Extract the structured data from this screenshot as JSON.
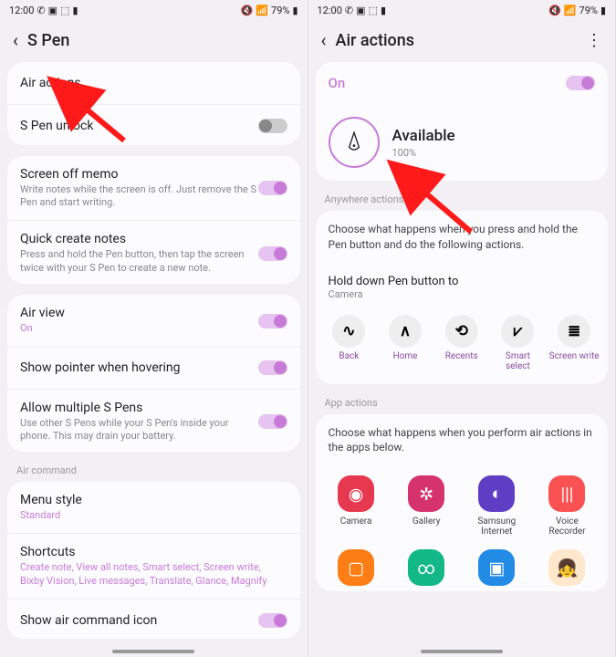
{
  "status": {
    "time": "12:00",
    "battery": "79%"
  },
  "left": {
    "title": "S Pen",
    "rows": {
      "air_actions": "Air actions",
      "unlock": "S Pen unlock",
      "memo_t": "Screen off memo",
      "memo_s": "Write notes while the screen is off. Just remove the S Pen and start writing.",
      "quick_t": "Quick create notes",
      "quick_s": "Press and hold the Pen button, then tap the screen twice with your S Pen to create a new note.",
      "airview_t": "Air view",
      "airview_s": "On",
      "pointer": "Show pointer when hovering",
      "multi_t": "Allow multiple S Pens",
      "multi_s": "Use other S Pens while your S Pen's inside your phone. This may drain your battery.",
      "sec_ac": "Air command",
      "menu_t": "Menu style",
      "menu_s": "Standard",
      "short_t": "Shortcuts",
      "short_s": "Create note, View all notes, Smart select, Screen write, Bixby Vision, Live messages, Translate, Glance, Magnify",
      "showicon": "Show air command icon"
    }
  },
  "right": {
    "title": "Air actions",
    "on": "On",
    "avail": "Available",
    "pct": "100%",
    "sec_anywhere": "Anywhere actions",
    "anywhere_desc": "Choose what happens when you press and hold the Pen button and do the following actions.",
    "hold_t": "Hold down Pen button to",
    "hold_s": "Camera",
    "acts": [
      "Back",
      "Home",
      "Recents",
      "Smart select",
      "Screen write"
    ],
    "sec_app": "App actions",
    "app_desc": "Choose what happens when you perform air actions in the apps below.",
    "apps": [
      "Camera",
      "Gallery",
      "Samsung Internet",
      "Voice Recorder"
    ]
  }
}
